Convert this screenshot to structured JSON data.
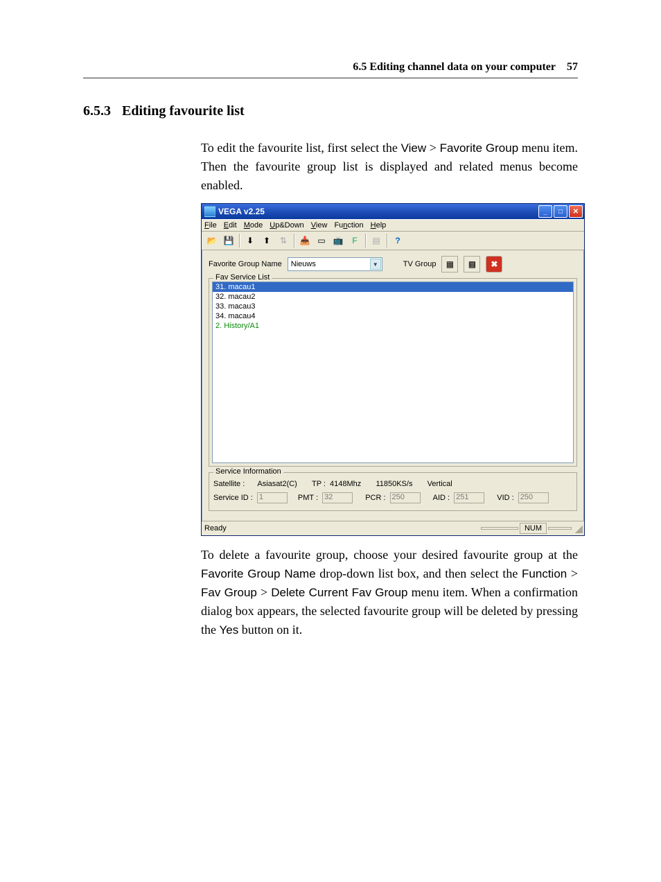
{
  "header": {
    "section": "6.5 Editing channel data on your computer",
    "page": "57"
  },
  "section": {
    "number": "6.5.3",
    "title": "Editing favourite list"
  },
  "intro": {
    "p1a": "To edit the favourite list, first select the ",
    "p1b": "View",
    "p1c": " > ",
    "p1d": "Favorite Group",
    "p1e": " menu item.  Then the favourite group list is displayed and related menus become enabled."
  },
  "outro": {
    "a": "To delete a favourite group, choose your desired favourite group at the ",
    "b": "Favorite Group Name",
    "c": " drop-down list box, and then select the ",
    "d": "Function",
    "e": " > ",
    "f": "Fav Group",
    "g": " > ",
    "h": "Delete Current Fav Group",
    "i": " menu item.  When a confirmation dialog box appears, the selected favourite group will be deleted by pressing the ",
    "j": "Yes",
    "k": " button on it."
  },
  "app": {
    "title": "VEGA v2.25",
    "menus": {
      "file": "File",
      "edit": "Edit",
      "mode": "Mode",
      "updown": "Up&Down",
      "view": "View",
      "function": "Function",
      "help": "Help"
    },
    "labels": {
      "favGroupName": "Favorite Group Name",
      "tvGroup": "TV Group",
      "favServiceList": "Fav Service List",
      "serviceInfo": "Service Information"
    },
    "dropdown": {
      "value": "Nieuws"
    },
    "list": [
      {
        "text": "31. macau1",
        "selected": true
      },
      {
        "text": "32. macau2"
      },
      {
        "text": "33. macau3"
      },
      {
        "text": "34. macau4"
      },
      {
        "text": "2. History/A1",
        "green": true
      }
    ],
    "svc": {
      "satLabel": "Satellite :",
      "sat": "Asiasat2(C)",
      "tpLabel": "TP :",
      "tp": "4148Mhz",
      "rate": "11850KS/s",
      "pol": "Vertical",
      "sidLabel": "Service ID :",
      "sid": "1",
      "pmtLabel": "PMT :",
      "pmt": "32",
      "pcrLabel": "PCR :",
      "pcr": "250",
      "aidLabel": "AID :",
      "aid": "251",
      "vidLabel": "VID :",
      "vid": "250"
    },
    "status": {
      "ready": "Ready",
      "num": "NUM"
    }
  }
}
